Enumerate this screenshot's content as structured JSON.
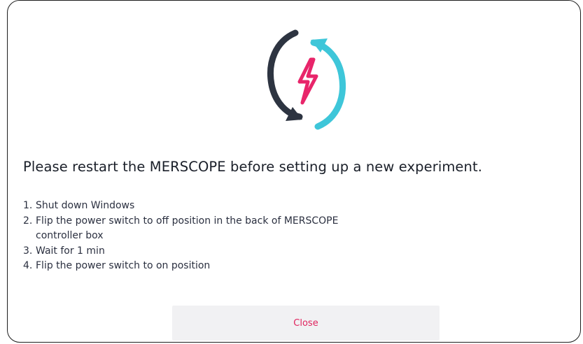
{
  "dialog": {
    "icon": "restart-power-icon",
    "title": "Please restart the MERSCOPE before setting up a new experiment.",
    "steps": [
      {
        "number": "1.",
        "text": "Shut down Windows",
        "continuation": ""
      },
      {
        "number": "2.",
        "text": "Flip the power switch to off position in the back of MERSCOPE",
        "continuation": "controller box"
      },
      {
        "number": "3.",
        "text": "Wait for 1 min",
        "continuation": ""
      },
      {
        "number": "4.",
        "text": "Flip the power switch to on position",
        "continuation": ""
      }
    ],
    "close_label": "Close"
  },
  "colors": {
    "dark_arrow": "#2d3441",
    "cyan_arrow": "#3ec6d9",
    "bolt": "#e8256a",
    "close_text": "#e0245e",
    "button_bg": "#f1f1f3"
  }
}
